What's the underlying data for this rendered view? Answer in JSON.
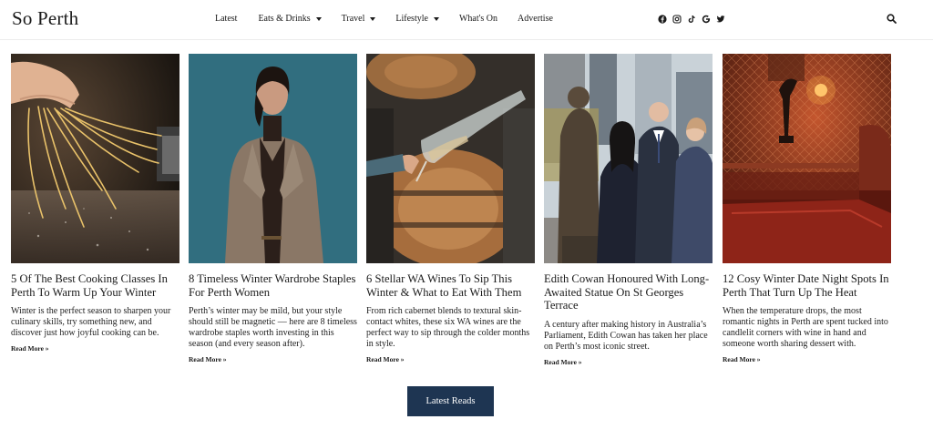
{
  "brand": {
    "logo_text": "So Perth"
  },
  "nav": {
    "items": [
      {
        "label": "Latest",
        "dropdown": false
      },
      {
        "label": "Eats & Drinks",
        "dropdown": true
      },
      {
        "label": "Travel",
        "dropdown": true
      },
      {
        "label": "Lifestyle",
        "dropdown": true
      },
      {
        "label": "What's On",
        "dropdown": false
      },
      {
        "label": "Advertise",
        "dropdown": false
      }
    ]
  },
  "socials": [
    "facebook-icon",
    "instagram-icon",
    "tiktok-icon",
    "google-icon",
    "twitter-icon"
  ],
  "articles": [
    {
      "title": "5 Of The Best Cooking Classes In Perth To Warm Up Your Winter",
      "excerpt": "Winter is the perfect season to sharpen your culinary skills, try something new, and discover just how joyful cooking can be.",
      "read_more": "Read More »"
    },
    {
      "title": "8 Timeless Winter Wardrobe Staples For Perth Women",
      "excerpt": "Perth’s winter may be mild, but your style should still be magnetic — here are 8 timeless wardrobe staples worth investing in this season (and every season after).",
      "read_more": "Read More »"
    },
    {
      "title": "6 Stellar WA Wines To Sip This Winter & What to Eat With Them",
      "excerpt": "From rich cabernet blends to textural skin-contact whites, these six WA wines are the perfect way to sip through the colder months in style.",
      "read_more": "Read More »"
    },
    {
      "title": "Edith Cowan Honoured With Long-Awaited Statue On St Georges Terrace",
      "excerpt": "A century after making history in Australia’s Parliament, Edith Cowan has taken her place on Perth’s most iconic street.",
      "read_more": "Read More »"
    },
    {
      "title": "12 Cosy Winter Date Night Spots In Perth That Turn Up The Heat",
      "excerpt": "When the temperature drops, the most romantic nights in Perth are spent tucked into candlelit corners with wine in hand and someone worth sharing dessert with.",
      "read_more": "Read More »"
    }
  ],
  "latest_reads_button": "Latest Reads",
  "colors": {
    "button_bg": "#1e3552",
    "text": "#1a1a1a"
  }
}
